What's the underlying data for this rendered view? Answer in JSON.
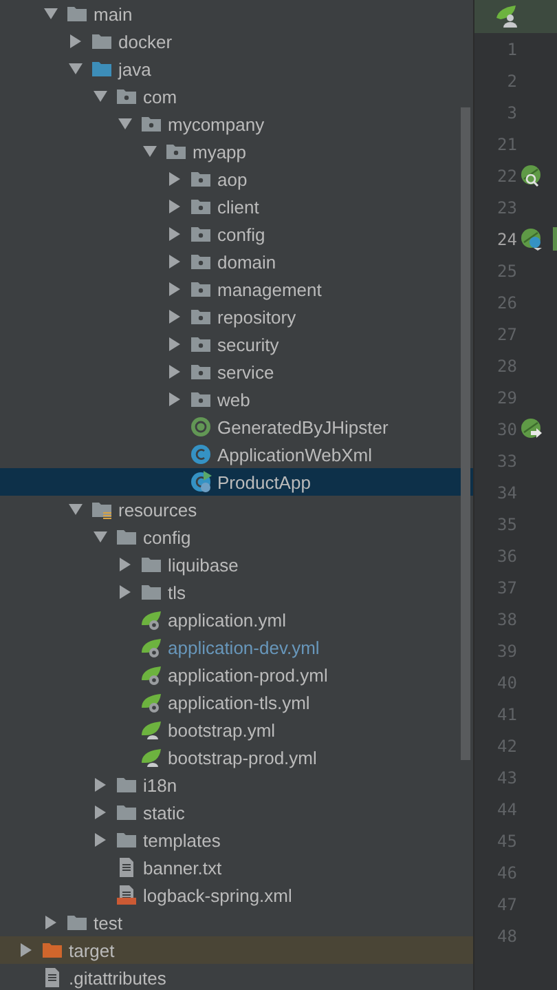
{
  "project_tree": {
    "items": [
      {
        "children": [
          {
            "label": "main",
            "kind": "folder",
            "expanded": true,
            "children": [
              {
                "label": "docker",
                "kind": "folder",
                "expanded": false
              },
              {
                "label": "java",
                "kind": "source-folder",
                "expanded": true,
                "children": [
                  {
                    "label": "com",
                    "kind": "package",
                    "expanded": true,
                    "children": [
                      {
                        "label": "mycompany",
                        "kind": "package",
                        "expanded": true,
                        "children": [
                          {
                            "label": "myapp",
                            "kind": "package",
                            "expanded": true,
                            "children": [
                              {
                                "label": "aop",
                                "kind": "package",
                                "expanded": false
                              },
                              {
                                "label": "client",
                                "kind": "package",
                                "expanded": false
                              },
                              {
                                "label": "config",
                                "kind": "package",
                                "expanded": false
                              },
                              {
                                "label": "domain",
                                "kind": "package",
                                "expanded": false
                              },
                              {
                                "label": "management",
                                "kind": "package",
                                "expanded": false
                              },
                              {
                                "label": "repository",
                                "kind": "package",
                                "expanded": false
                              },
                              {
                                "label": "security",
                                "kind": "package",
                                "expanded": false
                              },
                              {
                                "label": "service",
                                "kind": "package",
                                "expanded": false
                              },
                              {
                                "label": "web",
                                "kind": "package",
                                "expanded": false
                              },
                              {
                                "label": "GeneratedByJHipster",
                                "kind": "annotation",
                                "selected": false,
                                "modified": false
                              },
                              {
                                "label": "ApplicationWebXml",
                                "kind": "class",
                                "selected": false,
                                "modified": false
                              },
                              {
                                "label": "ProductApp",
                                "kind": "boot-class",
                                "selected": true,
                                "modified": false
                              }
                            ]
                          }
                        ]
                      }
                    ]
                  }
                ]
              },
              {
                "label": "resources",
                "kind": "resources-folder",
                "expanded": true,
                "children": [
                  {
                    "label": "config",
                    "kind": "folder",
                    "expanded": true,
                    "children": [
                      {
                        "label": "liquibase",
                        "kind": "folder",
                        "expanded": false
                      },
                      {
                        "label": "tls",
                        "kind": "folder",
                        "expanded": false
                      },
                      {
                        "label": "application.yml",
                        "kind": "spring-config",
                        "selected": false,
                        "modified": false
                      },
                      {
                        "label": "application-dev.yml",
                        "kind": "spring-config",
                        "selected": false,
                        "modified": true
                      },
                      {
                        "label": "application-prod.yml",
                        "kind": "spring-config",
                        "selected": false,
                        "modified": false
                      },
                      {
                        "label": "application-tls.yml",
                        "kind": "spring-config",
                        "selected": false,
                        "modified": false
                      },
                      {
                        "label": "bootstrap.yml",
                        "kind": "spring-bootstrap",
                        "selected": false,
                        "modified": false
                      },
                      {
                        "label": "bootstrap-prod.yml",
                        "kind": "spring-bootstrap",
                        "selected": false,
                        "modified": false
                      }
                    ]
                  },
                  {
                    "label": "i18n",
                    "kind": "folder",
                    "expanded": false
                  },
                  {
                    "label": "static",
                    "kind": "folder",
                    "expanded": false
                  },
                  {
                    "label": "templates",
                    "kind": "folder",
                    "expanded": false
                  },
                  {
                    "label": "banner.txt",
                    "kind": "text-file",
                    "selected": false,
                    "modified": false
                  },
                  {
                    "label": "logback-spring.xml",
                    "kind": "xml-file",
                    "selected": false,
                    "modified": false
                  }
                ]
              }
            ]
          },
          {
            "label": "test",
            "kind": "folder",
            "expanded": false
          }
        ]
      },
      {
        "label": "target",
        "kind": "excluded-folder",
        "expanded": false
      },
      {
        "label": ".gitattributes",
        "kind": "text-file",
        "selected": false,
        "modified": false
      }
    ]
  },
  "gutter": {
    "lines": [
      {
        "number": "1",
        "current": false,
        "changed": false
      },
      {
        "number": "2",
        "current": false,
        "changed": false
      },
      {
        "number": "3",
        "current": false,
        "changed": false
      },
      {
        "number": "21",
        "current": false,
        "changed": false
      },
      {
        "number": "22",
        "current": false,
        "changed": false,
        "kind": "search"
      },
      {
        "number": "23",
        "current": false,
        "changed": false
      },
      {
        "number": "24",
        "current": true,
        "changed": true,
        "kind": "bean"
      },
      {
        "number": "25",
        "current": false,
        "changed": false
      },
      {
        "number": "26",
        "current": false,
        "changed": false
      },
      {
        "number": "27",
        "current": false,
        "changed": false
      },
      {
        "number": "28",
        "current": false,
        "changed": false
      },
      {
        "number": "29",
        "current": false,
        "changed": false
      },
      {
        "number": "30",
        "current": false,
        "changed": false,
        "kind": "navigate"
      },
      {
        "number": "33",
        "current": false,
        "changed": false
      },
      {
        "number": "34",
        "current": false,
        "changed": false
      },
      {
        "number": "35",
        "current": false,
        "changed": false
      },
      {
        "number": "36",
        "current": false,
        "changed": false
      },
      {
        "number": "37",
        "current": false,
        "changed": false
      },
      {
        "number": "38",
        "current": false,
        "changed": false
      },
      {
        "number": "39",
        "current": false,
        "changed": false
      },
      {
        "number": "40",
        "current": false,
        "changed": false
      },
      {
        "number": "41",
        "current": false,
        "changed": false
      },
      {
        "number": "42",
        "current": false,
        "changed": false
      },
      {
        "number": "43",
        "current": false,
        "changed": false
      },
      {
        "number": "44",
        "current": false,
        "changed": false
      },
      {
        "number": "45",
        "current": false,
        "changed": false
      },
      {
        "number": "46",
        "current": false,
        "changed": false
      },
      {
        "number": "47",
        "current": false,
        "changed": false
      },
      {
        "number": "48",
        "current": false,
        "changed": false
      }
    ]
  }
}
